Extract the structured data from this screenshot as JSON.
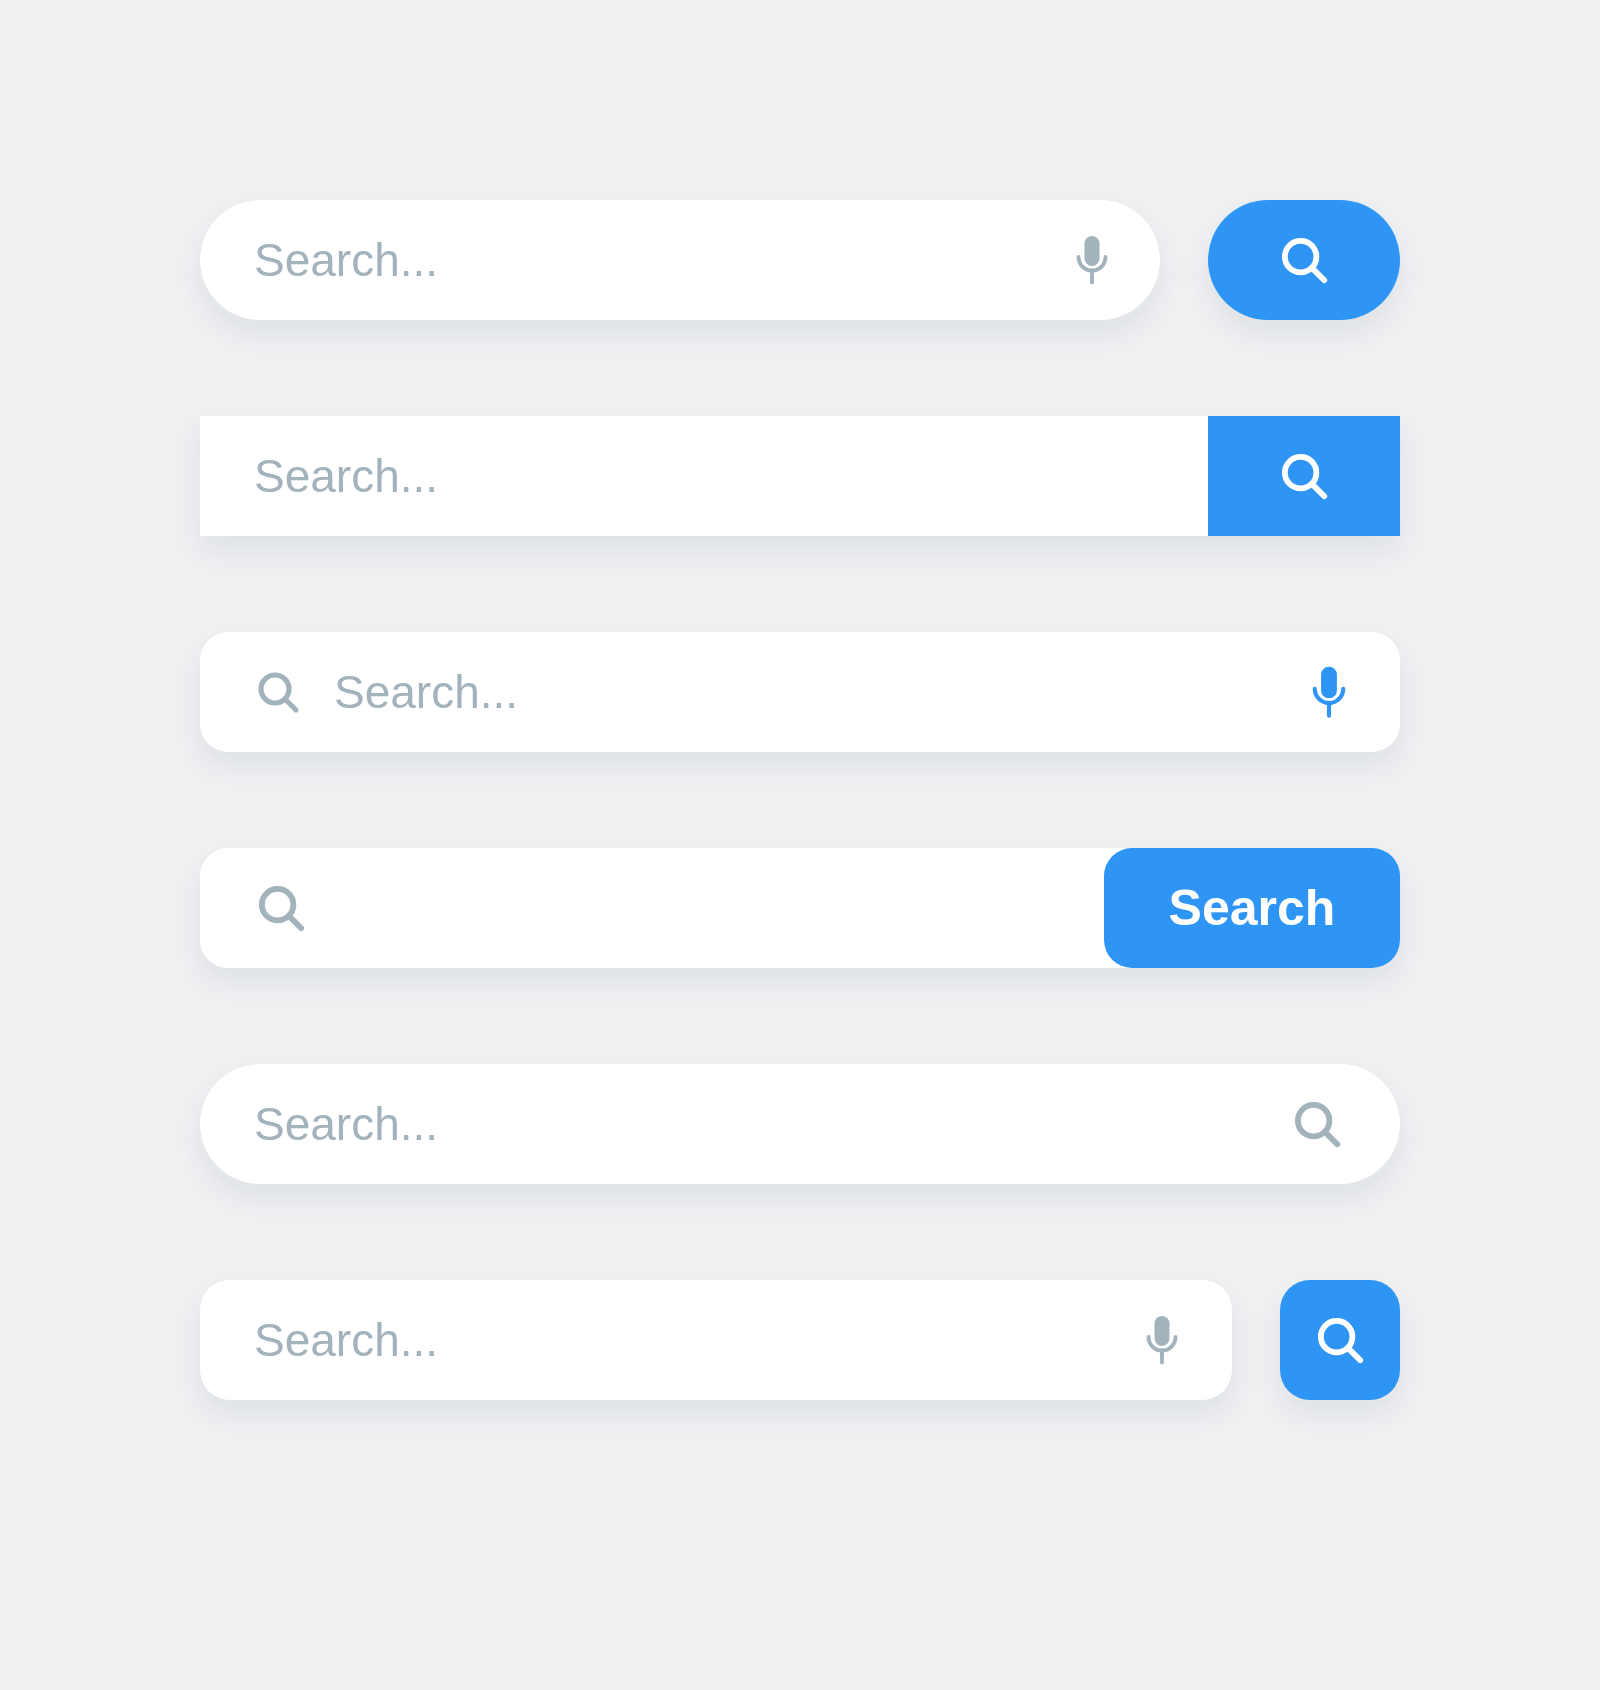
{
  "search_bars": [
    {
      "kind": "pill-mic-round-button",
      "placeholder": "Search..."
    },
    {
      "kind": "square-button",
      "placeholder": "Search..."
    },
    {
      "kind": "icon-left-mic",
      "placeholder": "Search..."
    },
    {
      "kind": "icon-left-text-button",
      "button": "Search"
    },
    {
      "kind": "pill-icon-right",
      "placeholder": "Search..."
    },
    {
      "kind": "mic-square-button",
      "placeholder": "Search..."
    }
  ]
}
